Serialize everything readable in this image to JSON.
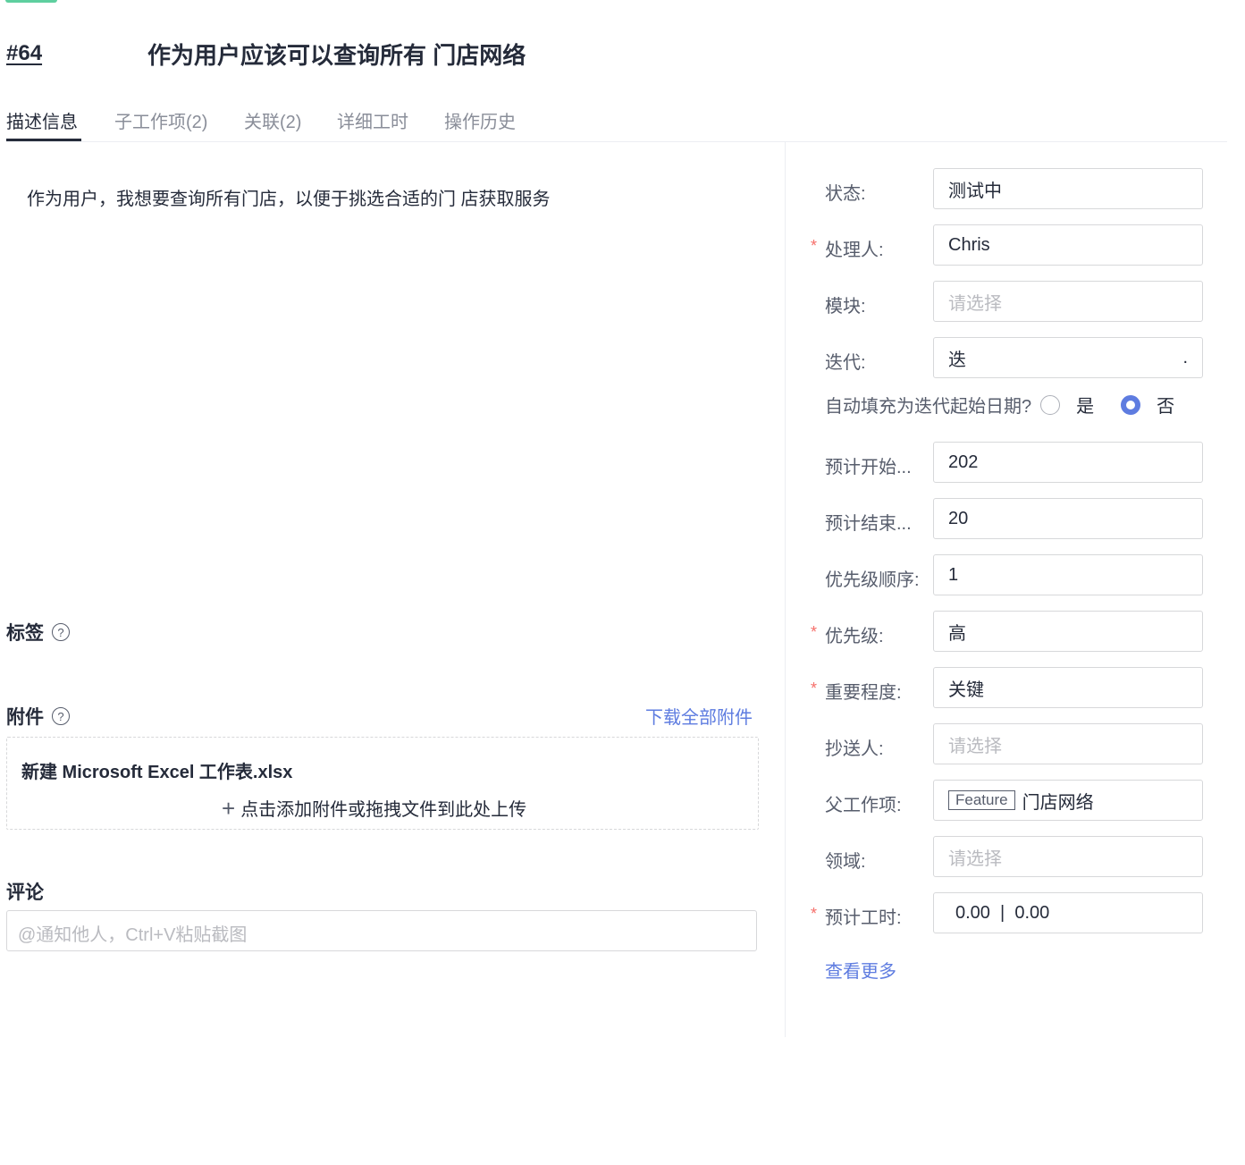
{
  "header": {
    "ticket_id": "#64",
    "title": "作为用户应该可以查询所有 门店网络"
  },
  "tabs": [
    {
      "label": "描述信息",
      "active": true
    },
    {
      "label": "子工作项(2)"
    },
    {
      "label": "关联(2)"
    },
    {
      "label": "详细工时"
    },
    {
      "label": "操作历史"
    }
  ],
  "description": "作为用户，我想要查询所有门店，以便于挑选合适的门 店获取服务",
  "labels_section": {
    "title": "标签",
    "help_icon": "?"
  },
  "attachments": {
    "title": "附件",
    "help_icon": "?",
    "download_all": "下载全部附件",
    "files": [
      "新建 Microsoft Excel 工作表.xlsx"
    ],
    "upload_plus": "+",
    "upload_hint": "点击添加附件或拖拽文件到此处上传"
  },
  "comments": {
    "title": "评论",
    "placeholder": "@通知他人，Ctrl+V粘贴截图"
  },
  "fields": {
    "status": {
      "label": "状态:",
      "value": "测试中"
    },
    "assignee": {
      "label": "处理人:",
      "value": "Chris",
      "required": "*"
    },
    "module": {
      "label": "模块:",
      "placeholder": "请选择"
    },
    "iteration": {
      "label": "迭代:",
      "value": "迭",
      "suffix": "."
    },
    "autofill": {
      "label": "自动填充为迭代起始日期?",
      "yes": "是",
      "no": "否",
      "selected": "否"
    },
    "planned_start": {
      "label": "预计开始...",
      "value": "202"
    },
    "planned_end": {
      "label": "预计结束...",
      "value": "20"
    },
    "priority_order": {
      "label": "优先级顺序:",
      "value": "1"
    },
    "priority": {
      "label": "优先级:",
      "value": "高",
      "required": "*"
    },
    "importance": {
      "label": "重要程度:",
      "value": "关键",
      "required": "*"
    },
    "cc": {
      "label": "抄送人:",
      "placeholder": "请选择"
    },
    "parent": {
      "label": "父工作项:",
      "tag": "Feature",
      "value": "门店网络"
    },
    "domain": {
      "label": "领域:",
      "placeholder": "请选择"
    },
    "estimate": {
      "label": "预计工时:",
      "value": "0.00  |  0.00",
      "required": "*"
    }
  },
  "view_more": "查看更多",
  "colors": {
    "accent": "#5e7ce0",
    "required": "#f66f6a",
    "top_tag": "#5ecf9f"
  }
}
